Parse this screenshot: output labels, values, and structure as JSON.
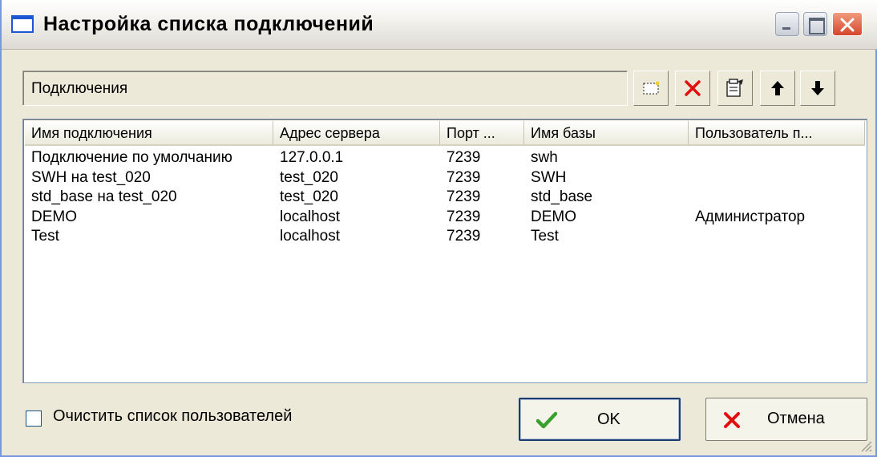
{
  "window": {
    "title": "Настройка списка подключений"
  },
  "toolbar": {
    "section_label": "Подключения",
    "buttons": [
      {
        "name": "new-connection",
        "icon": "new-item-icon"
      },
      {
        "name": "delete-connection",
        "icon": "red-x-icon"
      },
      {
        "name": "connection-properties",
        "icon": "properties-icon"
      },
      {
        "name": "move-up",
        "icon": "arrow-up-icon"
      },
      {
        "name": "move-down",
        "icon": "arrow-down-icon"
      }
    ]
  },
  "list": {
    "columns": [
      "Имя подключения",
      "Адрес сервера",
      "Порт ...",
      "Имя базы",
      "Пользователь п..."
    ],
    "rows": [
      [
        "Подключение по умолчанию",
        "127.0.0.1",
        "7239",
        "swh",
        ""
      ],
      [
        "SWH на test_020",
        "test_020",
        "7239",
        "SWH",
        ""
      ],
      [
        "std_base на test_020",
        "test_020",
        "7239",
        "std_base",
        ""
      ],
      [
        "DEMO",
        "localhost",
        "7239",
        "DEMO",
        "Администратор"
      ],
      [
        "Test",
        "localhost",
        "7239",
        "Test",
        ""
      ]
    ]
  },
  "footer": {
    "clear_users_label": "Очистить список пользователей",
    "clear_users_checked": false,
    "ok_label": "OK",
    "cancel_label": "Отмена"
  },
  "colors": {
    "title_accent": "#1b56d4",
    "close_button": "#d4472c",
    "ok_icon": "#3aa02c",
    "delete_icon": "#e01010"
  }
}
